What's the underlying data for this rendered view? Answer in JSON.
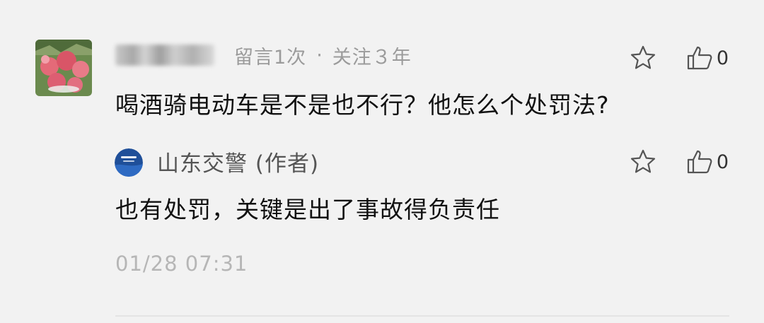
{
  "comment": {
    "meta": {
      "message_count": "留言1次",
      "separator": "·",
      "follow_duration": "关注３年"
    },
    "text": "喝酒骑电动车是不是也不行？他怎么个处罚法?",
    "like_count": "0",
    "icons": {
      "star": "star-icon",
      "like": "thumbs-up-icon"
    }
  },
  "reply": {
    "author": "山东交警 (作者)",
    "text": "也有处罚，关键是出了事故得负责任",
    "like_count": "0"
  },
  "timestamp": "01/28 07:31",
  "colors": {
    "background": "#f2f2f2",
    "primary_text": "#111111",
    "secondary_text": "#9b9b9b",
    "timestamp_text": "#b6b6b6",
    "icon_stroke": "#555555"
  }
}
